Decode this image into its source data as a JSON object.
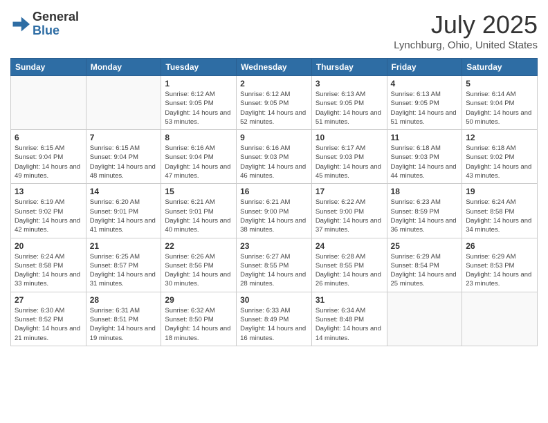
{
  "header": {
    "logo_general": "General",
    "logo_blue": "Blue",
    "month_title": "July 2025",
    "location": "Lynchburg, Ohio, United States"
  },
  "weekdays": [
    "Sunday",
    "Monday",
    "Tuesday",
    "Wednesday",
    "Thursday",
    "Friday",
    "Saturday"
  ],
  "weeks": [
    [
      {
        "day": "",
        "sunrise": "",
        "sunset": "",
        "daylight": ""
      },
      {
        "day": "",
        "sunrise": "",
        "sunset": "",
        "daylight": ""
      },
      {
        "day": "1",
        "sunrise": "Sunrise: 6:12 AM",
        "sunset": "Sunset: 9:05 PM",
        "daylight": "Daylight: 14 hours and 53 minutes."
      },
      {
        "day": "2",
        "sunrise": "Sunrise: 6:12 AM",
        "sunset": "Sunset: 9:05 PM",
        "daylight": "Daylight: 14 hours and 52 minutes."
      },
      {
        "day": "3",
        "sunrise": "Sunrise: 6:13 AM",
        "sunset": "Sunset: 9:05 PM",
        "daylight": "Daylight: 14 hours and 51 minutes."
      },
      {
        "day": "4",
        "sunrise": "Sunrise: 6:13 AM",
        "sunset": "Sunset: 9:05 PM",
        "daylight": "Daylight: 14 hours and 51 minutes."
      },
      {
        "day": "5",
        "sunrise": "Sunrise: 6:14 AM",
        "sunset": "Sunset: 9:04 PM",
        "daylight": "Daylight: 14 hours and 50 minutes."
      }
    ],
    [
      {
        "day": "6",
        "sunrise": "Sunrise: 6:15 AM",
        "sunset": "Sunset: 9:04 PM",
        "daylight": "Daylight: 14 hours and 49 minutes."
      },
      {
        "day": "7",
        "sunrise": "Sunrise: 6:15 AM",
        "sunset": "Sunset: 9:04 PM",
        "daylight": "Daylight: 14 hours and 48 minutes."
      },
      {
        "day": "8",
        "sunrise": "Sunrise: 6:16 AM",
        "sunset": "Sunset: 9:04 PM",
        "daylight": "Daylight: 14 hours and 47 minutes."
      },
      {
        "day": "9",
        "sunrise": "Sunrise: 6:16 AM",
        "sunset": "Sunset: 9:03 PM",
        "daylight": "Daylight: 14 hours and 46 minutes."
      },
      {
        "day": "10",
        "sunrise": "Sunrise: 6:17 AM",
        "sunset": "Sunset: 9:03 PM",
        "daylight": "Daylight: 14 hours and 45 minutes."
      },
      {
        "day": "11",
        "sunrise": "Sunrise: 6:18 AM",
        "sunset": "Sunset: 9:03 PM",
        "daylight": "Daylight: 14 hours and 44 minutes."
      },
      {
        "day": "12",
        "sunrise": "Sunrise: 6:18 AM",
        "sunset": "Sunset: 9:02 PM",
        "daylight": "Daylight: 14 hours and 43 minutes."
      }
    ],
    [
      {
        "day": "13",
        "sunrise": "Sunrise: 6:19 AM",
        "sunset": "Sunset: 9:02 PM",
        "daylight": "Daylight: 14 hours and 42 minutes."
      },
      {
        "day": "14",
        "sunrise": "Sunrise: 6:20 AM",
        "sunset": "Sunset: 9:01 PM",
        "daylight": "Daylight: 14 hours and 41 minutes."
      },
      {
        "day": "15",
        "sunrise": "Sunrise: 6:21 AM",
        "sunset": "Sunset: 9:01 PM",
        "daylight": "Daylight: 14 hours and 40 minutes."
      },
      {
        "day": "16",
        "sunrise": "Sunrise: 6:21 AM",
        "sunset": "Sunset: 9:00 PM",
        "daylight": "Daylight: 14 hours and 38 minutes."
      },
      {
        "day": "17",
        "sunrise": "Sunrise: 6:22 AM",
        "sunset": "Sunset: 9:00 PM",
        "daylight": "Daylight: 14 hours and 37 minutes."
      },
      {
        "day": "18",
        "sunrise": "Sunrise: 6:23 AM",
        "sunset": "Sunset: 8:59 PM",
        "daylight": "Daylight: 14 hours and 36 minutes."
      },
      {
        "day": "19",
        "sunrise": "Sunrise: 6:24 AM",
        "sunset": "Sunset: 8:58 PM",
        "daylight": "Daylight: 14 hours and 34 minutes."
      }
    ],
    [
      {
        "day": "20",
        "sunrise": "Sunrise: 6:24 AM",
        "sunset": "Sunset: 8:58 PM",
        "daylight": "Daylight: 14 hours and 33 minutes."
      },
      {
        "day": "21",
        "sunrise": "Sunrise: 6:25 AM",
        "sunset": "Sunset: 8:57 PM",
        "daylight": "Daylight: 14 hours and 31 minutes."
      },
      {
        "day": "22",
        "sunrise": "Sunrise: 6:26 AM",
        "sunset": "Sunset: 8:56 PM",
        "daylight": "Daylight: 14 hours and 30 minutes."
      },
      {
        "day": "23",
        "sunrise": "Sunrise: 6:27 AM",
        "sunset": "Sunset: 8:55 PM",
        "daylight": "Daylight: 14 hours and 28 minutes."
      },
      {
        "day": "24",
        "sunrise": "Sunrise: 6:28 AM",
        "sunset": "Sunset: 8:55 PM",
        "daylight": "Daylight: 14 hours and 26 minutes."
      },
      {
        "day": "25",
        "sunrise": "Sunrise: 6:29 AM",
        "sunset": "Sunset: 8:54 PM",
        "daylight": "Daylight: 14 hours and 25 minutes."
      },
      {
        "day": "26",
        "sunrise": "Sunrise: 6:29 AM",
        "sunset": "Sunset: 8:53 PM",
        "daylight": "Daylight: 14 hours and 23 minutes."
      }
    ],
    [
      {
        "day": "27",
        "sunrise": "Sunrise: 6:30 AM",
        "sunset": "Sunset: 8:52 PM",
        "daylight": "Daylight: 14 hours and 21 minutes."
      },
      {
        "day": "28",
        "sunrise": "Sunrise: 6:31 AM",
        "sunset": "Sunset: 8:51 PM",
        "daylight": "Daylight: 14 hours and 19 minutes."
      },
      {
        "day": "29",
        "sunrise": "Sunrise: 6:32 AM",
        "sunset": "Sunset: 8:50 PM",
        "daylight": "Daylight: 14 hours and 18 minutes."
      },
      {
        "day": "30",
        "sunrise": "Sunrise: 6:33 AM",
        "sunset": "Sunset: 8:49 PM",
        "daylight": "Daylight: 14 hours and 16 minutes."
      },
      {
        "day": "31",
        "sunrise": "Sunrise: 6:34 AM",
        "sunset": "Sunset: 8:48 PM",
        "daylight": "Daylight: 14 hours and 14 minutes."
      },
      {
        "day": "",
        "sunrise": "",
        "sunset": "",
        "daylight": ""
      },
      {
        "day": "",
        "sunrise": "",
        "sunset": "",
        "daylight": ""
      }
    ]
  ]
}
